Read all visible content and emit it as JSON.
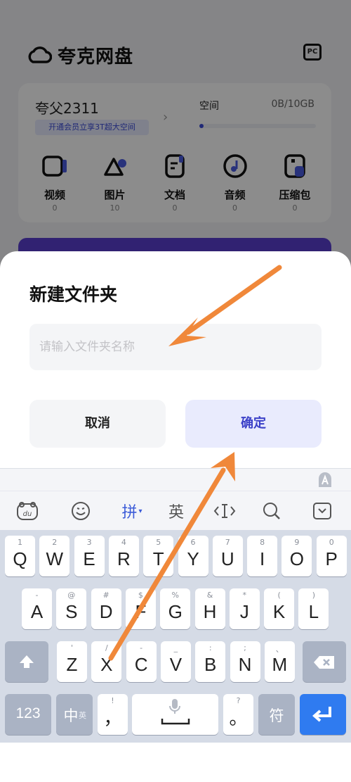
{
  "app": {
    "title": "夸克网盘",
    "pc_label": "PC",
    "user": {
      "name": "夸父2311",
      "vip_text": "开通会员立享3T超大空间"
    },
    "storage": {
      "label": "空间",
      "value": "0B/10GB",
      "used_fraction": 0.0
    },
    "categories": [
      {
        "label": "视频",
        "count": "0",
        "icon": "video-icon"
      },
      {
        "label": "图片",
        "count": "10",
        "icon": "image-icon"
      },
      {
        "label": "文档",
        "count": "0",
        "icon": "document-icon"
      },
      {
        "label": "音频",
        "count": "0",
        "icon": "audio-icon"
      },
      {
        "label": "压缩包",
        "count": "0",
        "icon": "archive-icon"
      }
    ]
  },
  "dialog": {
    "title": "新建文件夹",
    "input_placeholder": "请输入文件夹名称",
    "input_value": "",
    "cancel_label": "取消",
    "confirm_label": "确定"
  },
  "keyboard": {
    "toolbar": {
      "pinyin": "拼",
      "english": "英"
    },
    "rows": [
      [
        {
          "k": "Q",
          "s": "1"
        },
        {
          "k": "W",
          "s": "2"
        },
        {
          "k": "E",
          "s": "3"
        },
        {
          "k": "R",
          "s": "4"
        },
        {
          "k": "T",
          "s": "5"
        },
        {
          "k": "Y",
          "s": "6"
        },
        {
          "k": "U",
          "s": "7"
        },
        {
          "k": "I",
          "s": "8"
        },
        {
          "k": "O",
          "s": "9"
        },
        {
          "k": "P",
          "s": "0"
        }
      ],
      [
        {
          "k": "A",
          "s": "-"
        },
        {
          "k": "S",
          "s": "@"
        },
        {
          "k": "D",
          "s": "#"
        },
        {
          "k": "F",
          "s": "$"
        },
        {
          "k": "G",
          "s": "%"
        },
        {
          "k": "H",
          "s": "&"
        },
        {
          "k": "J",
          "s": "*"
        },
        {
          "k": "K",
          "s": "("
        },
        {
          "k": "L",
          "s": ")"
        }
      ],
      [
        {
          "k": "Z",
          "s": "'"
        },
        {
          "k": "X",
          "s": "/"
        },
        {
          "k": "C",
          "s": "-"
        },
        {
          "k": "V",
          "s": "_"
        },
        {
          "k": "B",
          "s": ":"
        },
        {
          "k": "N",
          "s": ";"
        },
        {
          "k": "M",
          "s": "、"
        }
      ]
    ],
    "num_label": "123",
    "lang_label": "中",
    "lang_sub": "英",
    "comma_label": "，",
    "comma_sub": "!",
    "period_label": "。",
    "period_sub": "?",
    "symbol_label": "符"
  },
  "colors": {
    "accent": "#3b5bd8",
    "arrow": "#f0883a",
    "enter": "#2f7bf0"
  }
}
